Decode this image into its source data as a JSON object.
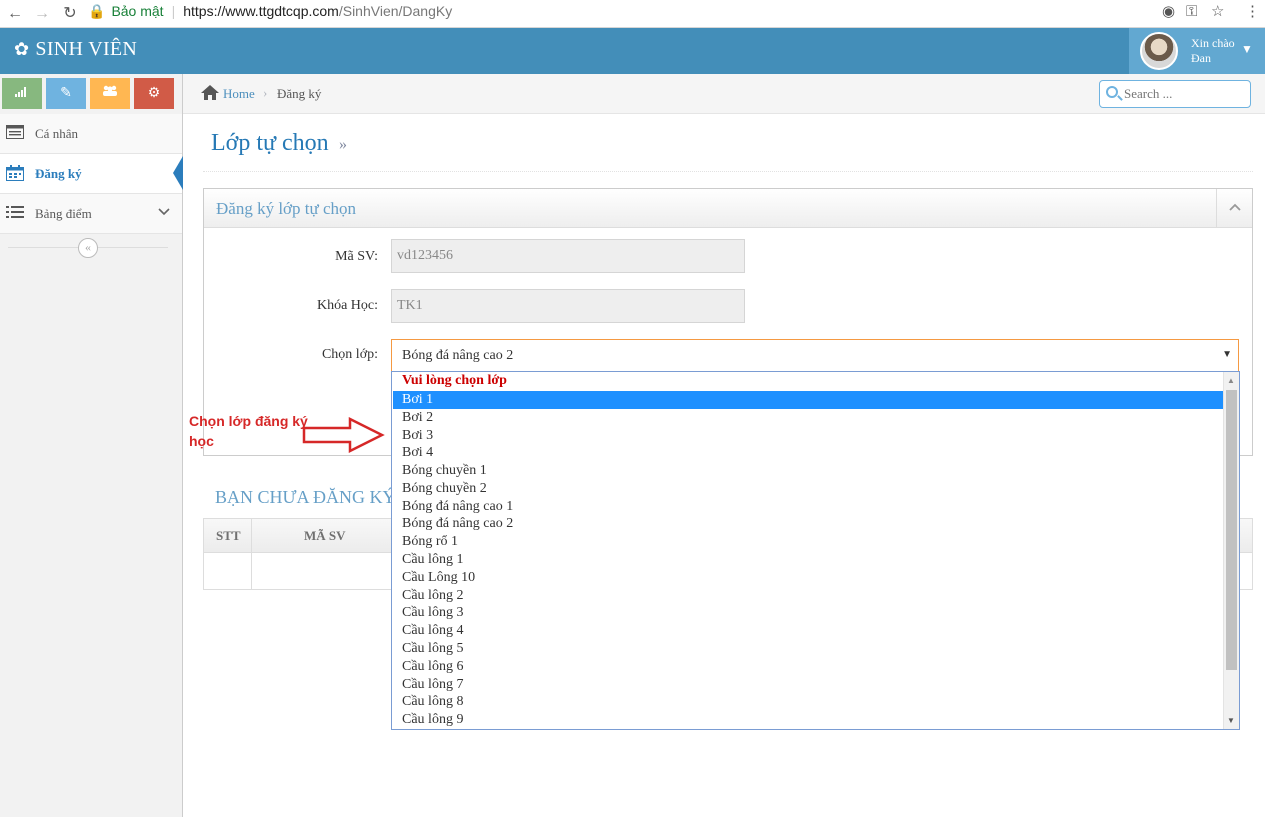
{
  "browser": {
    "back": "←",
    "forward": "→",
    "reload": "↻",
    "secure_label": "Bảo mật",
    "url_host": "https://www.ttgdtcqp.com",
    "url_path": "/SinhVien/DangKy"
  },
  "header": {
    "brand": "SINH VIÊN",
    "greeting_line1": "Xin chào",
    "greeting_line2": "Đan",
    "accent_color": "#438eb9"
  },
  "sidebar": {
    "shortcuts": [
      {
        "icon": "signal-icon",
        "color": "#87b87f"
      },
      {
        "icon": "pencil-icon",
        "color": "#6fb3e0"
      },
      {
        "icon": "users-icon",
        "color": "#ffb752"
      },
      {
        "icon": "cogs-icon",
        "color": "#d15b47"
      }
    ],
    "items": [
      {
        "label": "Cá nhân",
        "icon": "list-alt-icon"
      },
      {
        "label": "Đăng ký",
        "icon": "calendar-icon",
        "active": true
      },
      {
        "label": "Bảng điểm",
        "icon": "list-icon"
      }
    ]
  },
  "breadcrumbs": {
    "home": "Home",
    "current": "Đăng ký"
  },
  "search": {
    "placeholder": "Search ..."
  },
  "page": {
    "title": "Lớp tự chọn",
    "title_suffix": "»"
  },
  "form": {
    "widget_title": "Đăng ký lớp tự chọn",
    "student_id_label": "Mã SV:",
    "student_id_value": "vd123456",
    "course_label": "Khóa Học:",
    "course_value": "TK1",
    "class_label": "Chọn lớp:",
    "class_value": "Bóng đá nâng cao 2"
  },
  "dropdown": {
    "placeholder": "Vui lòng chọn lớp",
    "options": [
      "Bơi 1",
      "Bơi 2",
      "Bơi 3",
      "Bơi 4",
      "Bóng chuyền 1",
      "Bóng chuyền 2",
      "Bóng đá nâng cao 1",
      "Bóng đá nâng cao 2",
      "Bóng rổ 1",
      "Cầu lông 1",
      "Cầu Lông 10",
      "Cầu lông 2",
      "Cầu lông 3",
      "Cầu lông 4",
      "Cầu lông 5",
      "Cầu lông 6",
      "Cầu lông 7",
      "Cầu lông 8",
      "Cầu lông 9"
    ],
    "highlighted": "Bơi 1"
  },
  "registration_table": {
    "title": "BẠN CHƯA ĐĂNG KÝ",
    "columns": [
      "STT",
      "MÃ SV"
    ]
  },
  "annotation": {
    "text": "Chọn lớp đăng ký học",
    "color": "#d62828"
  }
}
